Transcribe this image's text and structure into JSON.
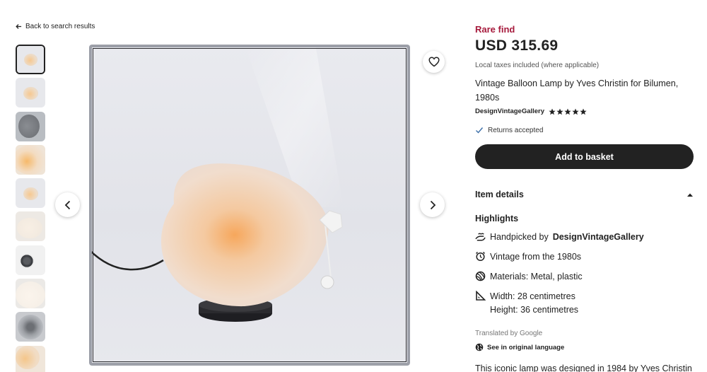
{
  "nav": {
    "back_label": "Back to search results"
  },
  "gallery": {
    "thumbnail_count": 10,
    "prev_label": "Previous image",
    "next_label": "Next image"
  },
  "product": {
    "badge": "Rare find",
    "price": "USD 315.69",
    "taxes_note": "Local taxes included (where applicable)",
    "title": "Vintage Balloon Lamp by Yves Christin for Bilumen, 1980s",
    "shop_name": "DesignVintageGallery",
    "rating_stars": 5,
    "returns": "Returns accepted",
    "add_to_basket": "Add to basket"
  },
  "details": {
    "section_label": "Item details",
    "highlights_label": "Highlights",
    "handpicked_prefix": "Handpicked by",
    "handpicked_shop": "DesignVintageGallery",
    "vintage": "Vintage from the 1980s",
    "materials": "Materials: Metal, plastic",
    "width": "Width: 28 centimetres",
    "height": "Height: 36 centimetres",
    "translated_by": "Translated by Google",
    "see_original": "See in original language",
    "description_start": "This iconic lamp was designed in 1984 by Yves Christin"
  },
  "colors": {
    "rare_find": "#a61a3c",
    "button_bg": "#222222",
    "returns_check": "#3b6ea8"
  }
}
